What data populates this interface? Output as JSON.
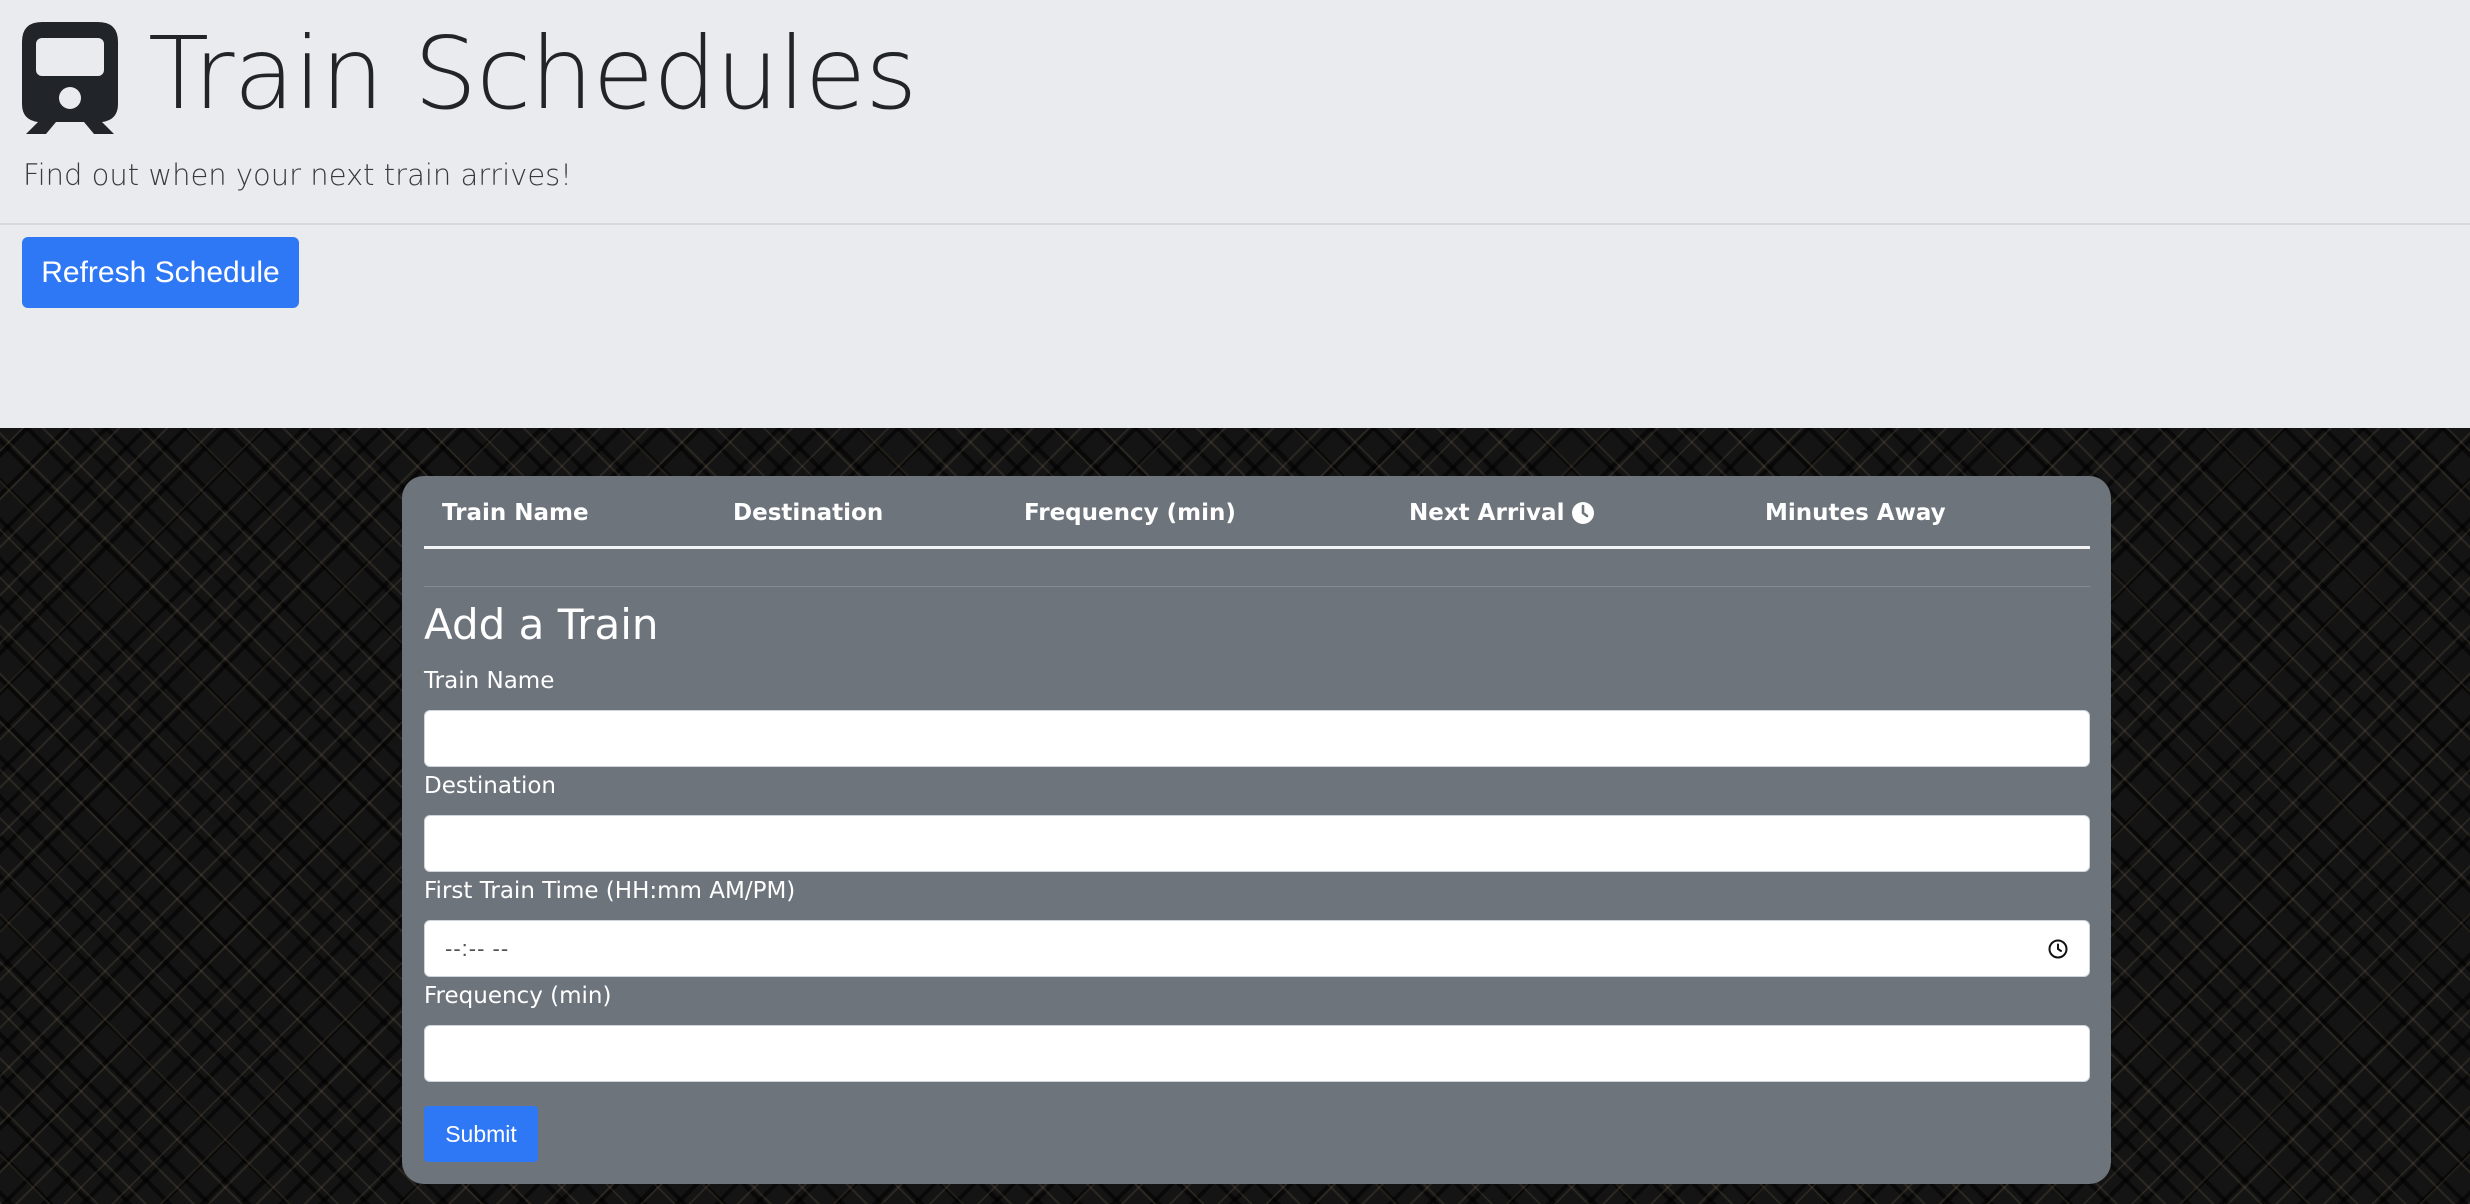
{
  "header": {
    "title": "Train Schedules",
    "lead": "Find out when your next train arrives!",
    "refresh_label": "Refresh Schedule"
  },
  "table": {
    "columns": [
      "Train Name",
      "Destination",
      "Frequency (min)",
      "Next Arrival",
      "Minutes Away"
    ],
    "rows": []
  },
  "form": {
    "title": "Add a Train",
    "fields": {
      "train_name": {
        "label": "Train Name",
        "value": ""
      },
      "destination": {
        "label": "Destination",
        "value": ""
      },
      "first_time": {
        "label": "First Train Time (HH:mm AM/PM)",
        "placeholder": "--:-- --"
      },
      "frequency": {
        "label": "Frequency (min)",
        "value": ""
      }
    },
    "submit_label": "Submit"
  },
  "icons": {
    "title_icon": "train-icon",
    "next_arrival_icon": "clock-icon",
    "time_input_icon": "clock-icon"
  },
  "colors": {
    "primary": "#2f78f5",
    "jumbotron_bg": "#e9ebef",
    "card_bg": "#6e747c"
  }
}
